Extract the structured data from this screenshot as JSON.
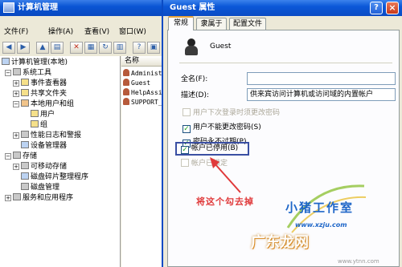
{
  "mmc": {
    "title": "计算机管理",
    "menu": [
      "文件(F)",
      "操作(A)",
      "查看(V)",
      "窗口(W)"
    ],
    "tree": [
      {
        "label": "计算机管理(本地)",
        "depth": 0,
        "icon": "computer-icon"
      },
      {
        "label": "系统工具",
        "depth": 1,
        "icon": "tools-icon"
      },
      {
        "label": "事件查看器",
        "depth": 2,
        "icon": "event-viewer-icon"
      },
      {
        "label": "共享文件夹",
        "depth": 2,
        "icon": "folder-icon"
      },
      {
        "label": "本地用户和组",
        "depth": 2,
        "icon": "users-icon"
      },
      {
        "label": "用户",
        "depth": 3,
        "icon": "folder-icon"
      },
      {
        "label": "组",
        "depth": 3,
        "icon": "folder-icon"
      },
      {
        "label": "性能日志和警报",
        "depth": 2,
        "icon": "performance-icon"
      },
      {
        "label": "设备管理器",
        "depth": 2,
        "icon": "device-manager-icon"
      },
      {
        "label": "存储",
        "depth": 1,
        "icon": "storage-icon"
      },
      {
        "label": "可移动存储",
        "depth": 2,
        "icon": "removable-storage-icon"
      },
      {
        "label": "磁盘碎片整理程序",
        "depth": 2,
        "icon": "defrag-icon"
      },
      {
        "label": "磁盘管理",
        "depth": 2,
        "icon": "disk-icon"
      },
      {
        "label": "服务和应用程序",
        "depth": 1,
        "icon": "services-icon"
      }
    ],
    "list_header": "名称",
    "list_items": [
      "Administ",
      "Guest",
      "HelpAssis",
      "SUPPORT_"
    ]
  },
  "dialog": {
    "title": "Guest 属性",
    "tabs": [
      "常规",
      "隶属于",
      "配置文件"
    ],
    "user_name": "Guest",
    "fields": {
      "fullname_label": "全名(F):",
      "fullname_value": "",
      "description_label": "描述(D):",
      "description_value": "供来宾访问计算机或访问域的内置帐户"
    },
    "checkboxes": [
      {
        "label": "用户下次登录时须更改密码",
        "checked": false,
        "disabled": true
      },
      {
        "label": "用户不能更改密码(S)",
        "checked": true,
        "disabled": false
      },
      {
        "label": "密码永不过期(P)",
        "checked": true,
        "disabled": false
      },
      {
        "label": "帐户已停用(B)",
        "checked": true,
        "disabled": false
      },
      {
        "label": "帐户已锁定",
        "checked": false,
        "disabled": true
      }
    ]
  },
  "annotation": "将这个勾去掉",
  "watermarks": {
    "studio": "小猪工作室",
    "url": "www.xzju.com",
    "site": "广东龙网",
    "site_url": "www.ytnn.com"
  },
  "colors": {
    "title_bar": "#0a55d4",
    "annotation": "#e0393a",
    "highlight_box": "#3a4fa3"
  }
}
